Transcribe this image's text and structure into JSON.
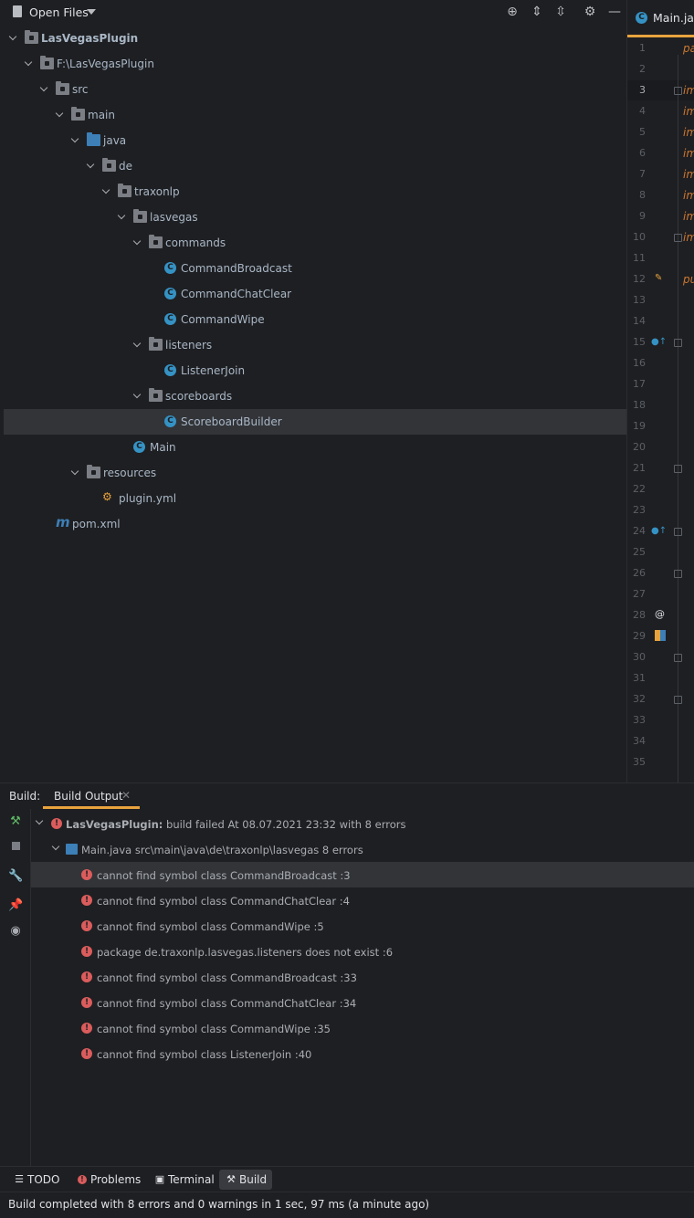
{
  "project": {
    "view_selector": "Open Files",
    "tree": [
      {
        "label": "LasVegasPlugin",
        "kind": "module"
      },
      {
        "label": "F:\\LasVegasPlugin",
        "kind": "module"
      },
      {
        "label": "src",
        "kind": "folder"
      },
      {
        "label": "main",
        "kind": "folder"
      },
      {
        "label": "java",
        "kind": "source-folder"
      },
      {
        "label": "de",
        "kind": "package"
      },
      {
        "label": "traxonlp",
        "kind": "package"
      },
      {
        "label": "lasvegas",
        "kind": "package"
      },
      {
        "label": "commands",
        "kind": "package"
      },
      {
        "label": "CommandBroadcast",
        "kind": "class"
      },
      {
        "label": "CommandChatClear",
        "kind": "class"
      },
      {
        "label": "CommandWipe",
        "kind": "class"
      },
      {
        "label": "listeners",
        "kind": "package"
      },
      {
        "label": "ListenerJoin",
        "kind": "class"
      },
      {
        "label": "scoreboards",
        "kind": "package"
      },
      {
        "label": "ScoreboardBuilder",
        "kind": "class",
        "selected": true
      },
      {
        "label": "Main",
        "kind": "main-class"
      },
      {
        "label": "resources",
        "kind": "resources"
      },
      {
        "label": "plugin.yml",
        "kind": "yml"
      },
      {
        "label": "pom.xml",
        "kind": "maven"
      }
    ]
  },
  "editor": {
    "tab_label": "Main.java",
    "line_numbers": [
      "1",
      "2",
      "3",
      "4",
      "5",
      "6",
      "7",
      "8",
      "9",
      "10",
      "11",
      "12",
      "13",
      "14",
      "15",
      "16",
      "17",
      "18",
      "19",
      "20",
      "21",
      "22",
      "23",
      "24",
      "25",
      "26",
      "27",
      "28",
      "29",
      "30",
      "31",
      "32",
      "33",
      "34",
      "35"
    ],
    "current_line": "3",
    "code_fragments": [
      {
        "line": "1",
        "text": "pa"
      },
      {
        "line": "3",
        "text": "im"
      },
      {
        "line": "4",
        "text": "im"
      },
      {
        "line": "5",
        "text": "im"
      },
      {
        "line": "6",
        "text": "im"
      },
      {
        "line": "7",
        "text": "im"
      },
      {
        "line": "8",
        "text": "im"
      },
      {
        "line": "9",
        "text": "im"
      },
      {
        "line": "10",
        "text": "im"
      },
      {
        "line": "12",
        "text": "pu"
      }
    ]
  },
  "build": {
    "prefix": "Build:",
    "tab_label": "Build Output",
    "summary": "LasVegasPlugin: build failed At 08.07.2021 23:32 with 8 errors",
    "summary_project": "LasVegasPlugin:",
    "summary_rest": " build failed At 08.07.2021 23:32 with 8 errors",
    "file_node": "Main.java src\\main\\java\\de\\traxonlp\\lasvegas 8 errors",
    "errors": [
      "cannot find symbol class CommandBroadcast :3",
      "cannot find symbol class CommandChatClear :4",
      "cannot find symbol class CommandWipe :5",
      "package de.traxonlp.lasvegas.listeners does not exist :6",
      "cannot find symbol class CommandBroadcast :33",
      "cannot find symbol class CommandChatClear :34",
      "cannot find symbol class CommandWipe :35",
      "cannot find symbol class ListenerJoin :40"
    ]
  },
  "tool_windows": {
    "todo": "TODO",
    "problems": "Problems",
    "terminal": "Terminal",
    "build": "Build"
  },
  "status": {
    "message": "Build completed with 8 errors and 0 warnings in 1 sec, 97 ms (a minute ago)"
  },
  "colors": {
    "background": "#1e1f22",
    "accent": "#e8a33d",
    "error": "#db5c5c",
    "class_icon": "#3592c4",
    "keyword": "#cc7832"
  }
}
